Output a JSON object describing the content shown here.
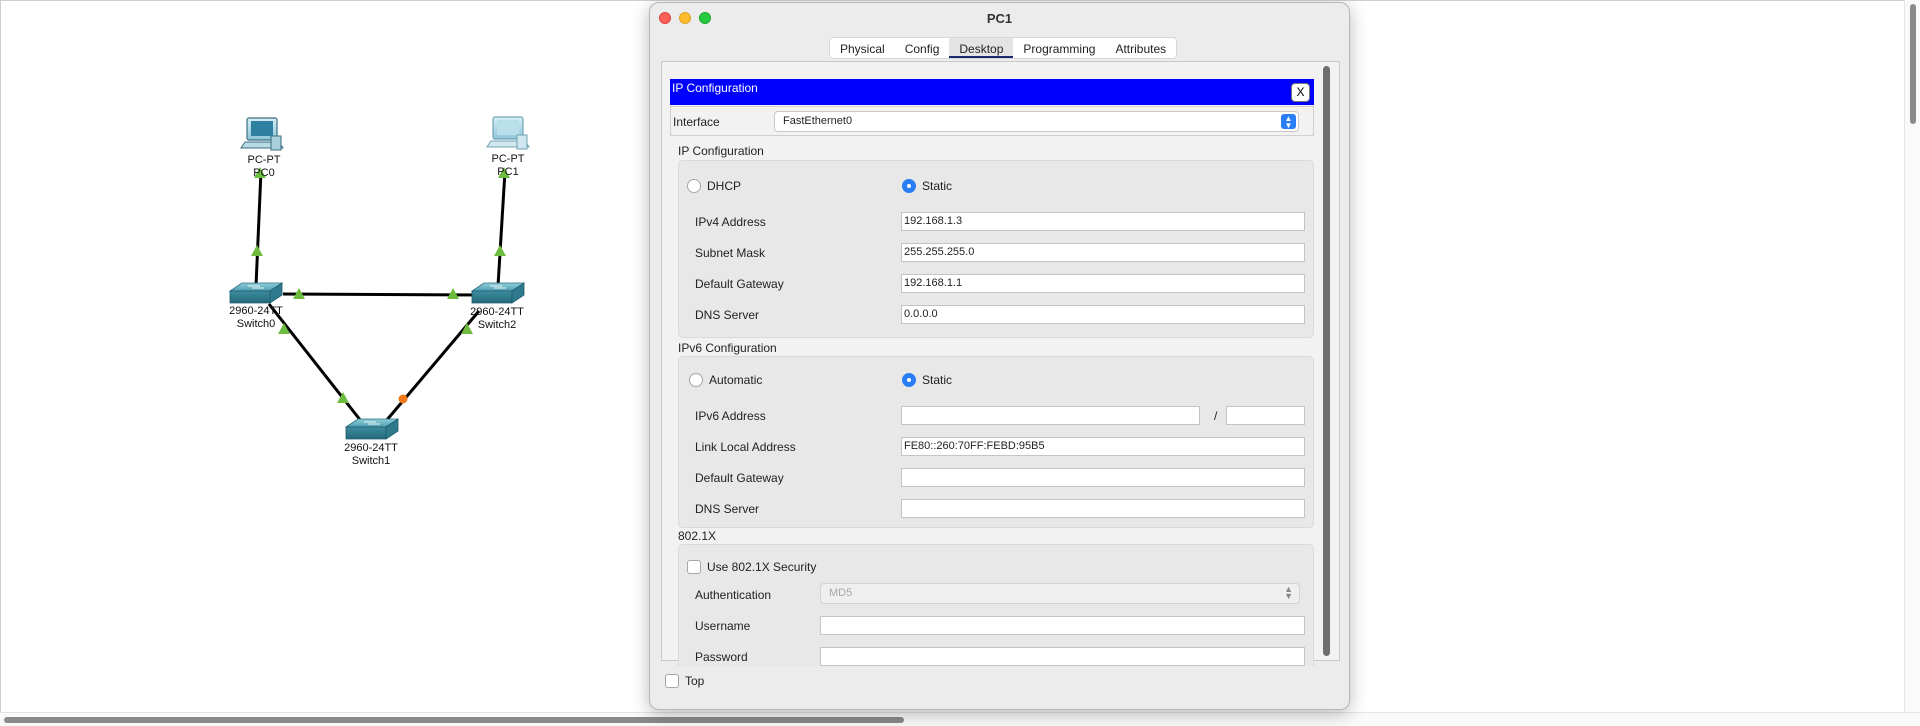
{
  "topology": {
    "devices": [
      {
        "id": "pc0",
        "model": "PC-PT",
        "name": "PC0"
      },
      {
        "id": "pc1",
        "model": "PC-PT",
        "name": "PC1"
      },
      {
        "id": "switch0",
        "model": "2960-24TT",
        "name": "Switch0"
      },
      {
        "id": "switch1",
        "model": "2960-24TT",
        "name": "Switch1"
      },
      {
        "id": "switch2",
        "model": "2960-24TT",
        "name": "Switch2"
      }
    ],
    "link_up_color": "#6dbb3f",
    "link_blocked_color": "#f07a1a"
  },
  "window": {
    "title": "PC1",
    "tabs": [
      "Physical",
      "Config",
      "Desktop",
      "Programming",
      "Attributes"
    ],
    "active_tab": "Desktop"
  },
  "ip_config": {
    "header": "IP Configuration",
    "close_label": "X",
    "interface_label": "Interface",
    "interface_value": "FastEthernet0",
    "ipv4_section": "IP Configuration",
    "dhcp_label": "DHCP",
    "static_label": "Static",
    "ipv4_mode": "Static",
    "ipv4_address_label": "IPv4 Address",
    "ipv4_address": "192.168.1.3",
    "subnet_mask_label": "Subnet Mask",
    "subnet_mask": "255.255.255.0",
    "default_gateway_label": "Default Gateway",
    "default_gateway": "192.168.1.1",
    "dns_server_label": "DNS Server",
    "dns_server": "0.0.0.0",
    "ipv6_section": "IPv6 Configuration",
    "automatic_label": "Automatic",
    "ipv6_static_label": "Static",
    "ipv6_mode": "Static",
    "ipv6_address_label": "IPv6 Address",
    "ipv6_address": "",
    "ipv6_prefix_separator": "/",
    "ipv6_prefix": "",
    "link_local_label": "Link Local Address",
    "link_local": "FE80::260:70FF:FEBD:95B5",
    "ipv6_gateway_label": "Default Gateway",
    "ipv6_gateway": "",
    "ipv6_dns_label": "DNS Server",
    "ipv6_dns": "",
    "dot1x_section": "802.1X",
    "use_8021x_label": "Use 802.1X Security",
    "authentication_label": "Authentication",
    "authentication_value": "MD5",
    "username_label": "Username",
    "username": "",
    "password_label": "Password",
    "password": ""
  },
  "footer": {
    "top_label": "Top"
  },
  "colors": {
    "header_blue": "#0000ff",
    "radio_blue": "#2a7ef5"
  }
}
